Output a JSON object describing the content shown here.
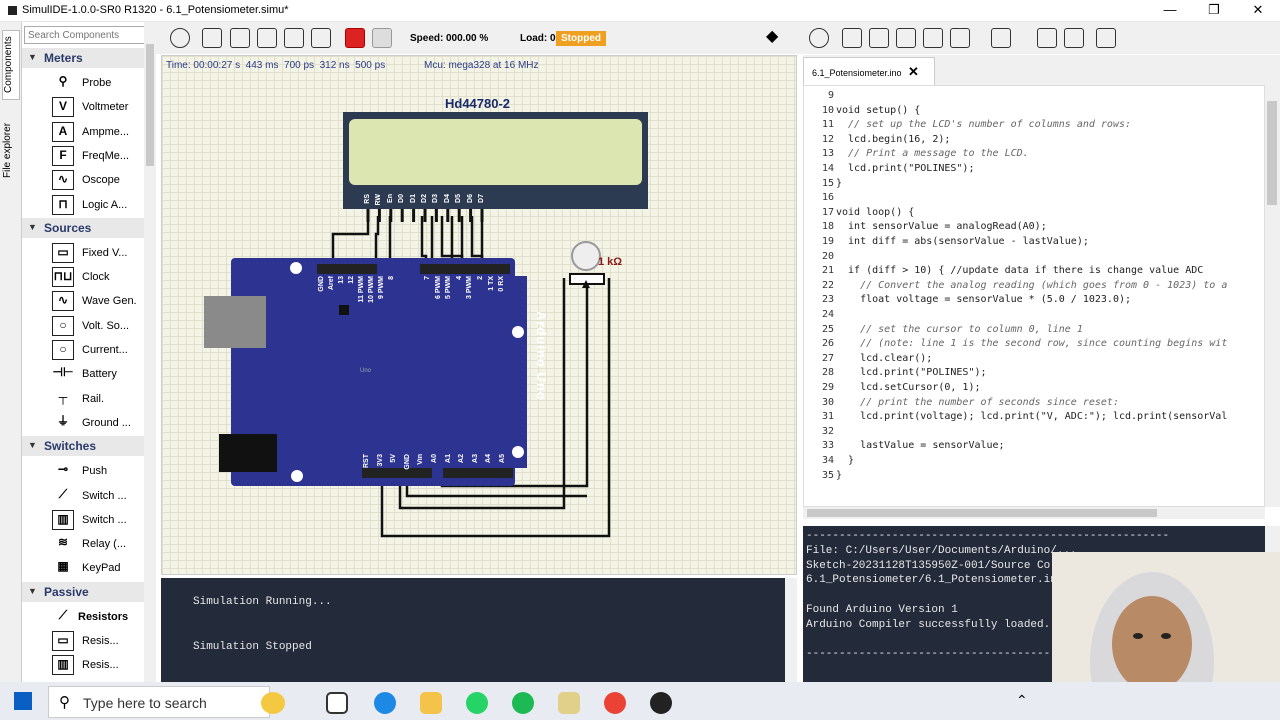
{
  "window": {
    "title": "SimulIDE-1.0.0-SR0 R1320 - 6.1_Potensiometer.simu*",
    "minimize": "—",
    "maximize": "❐",
    "close": "✕"
  },
  "sidebar_tabs": [
    "Components",
    "File explorer"
  ],
  "components": {
    "search_placeholder": "Search Components",
    "categories": [
      {
        "name": "Meters",
        "items": [
          {
            "label": "Probe",
            "icon": "probe-icon",
            "glyph": "⚲"
          },
          {
            "label": "Voltmeter",
            "icon": "voltmeter-icon",
            "glyph": "V"
          },
          {
            "label": "Ampme...",
            "icon": "ammeter-icon",
            "glyph": "A"
          },
          {
            "label": "FreqMe...",
            "icon": "freqmeter-icon",
            "glyph": "F"
          },
          {
            "label": "Oscope",
            "icon": "oscope-icon",
            "glyph": "∿"
          },
          {
            "label": "Logic A...",
            "icon": "logic-analyzer-icon",
            "glyph": "⊓"
          }
        ]
      },
      {
        "name": "Sources",
        "items": [
          {
            "label": "Fixed V...",
            "icon": "fixed-voltage-icon",
            "glyph": "▭"
          },
          {
            "label": "Clock",
            "icon": "clock-icon",
            "glyph": "⊓⊔"
          },
          {
            "label": "Wave Gen.",
            "icon": "wave-gen-icon",
            "glyph": "∿"
          },
          {
            "label": "Volt. So...",
            "icon": "voltage-source-icon",
            "glyph": "○"
          },
          {
            "label": "Current...",
            "icon": "current-source-icon",
            "glyph": "○"
          },
          {
            "label": "Battery",
            "icon": "battery-icon",
            "glyph": "⊣⊢"
          },
          {
            "label": "Rail.",
            "icon": "rail-icon",
            "glyph": "┬"
          },
          {
            "label": "Ground ...",
            "icon": "ground-icon",
            "glyph": "⏚"
          }
        ]
      },
      {
        "name": "Switches",
        "items": [
          {
            "label": "Push",
            "icon": "push-icon",
            "glyph": "⊸"
          },
          {
            "label": "Switch ...",
            "icon": "switch-icon",
            "glyph": "⟋"
          },
          {
            "label": "Switch ...",
            "icon": "switch-dip-icon",
            "glyph": "▥"
          },
          {
            "label": "Relay (...",
            "icon": "relay-icon",
            "glyph": "≋"
          },
          {
            "label": "KeyPad",
            "icon": "keypad-icon",
            "glyph": "▦"
          }
        ]
      },
      {
        "name": "Passive",
        "items": [
          {
            "label": "Resistors",
            "icon": "resistors-icon",
            "glyph": "⟋",
            "sub": true
          },
          {
            "label": "Resis...",
            "icon": "resistor-icon",
            "glyph": "▭"
          },
          {
            "label": "Resis...",
            "icon": "resistor-array-icon",
            "glyph": "▥"
          }
        ]
      }
    ]
  },
  "toolbar": {
    "speed_label": "Speed:",
    "speed_value": "000.00 %",
    "load_label": "Load:",
    "load_value": "000 %",
    "status": "Stopped"
  },
  "circuit": {
    "time": "Time: 00:00:27 s  443 ms  700 ps  312 ns  500 ps",
    "mcu": "Mcu: mega328 at 16 MHz",
    "lcd_title": "Hd44780-2",
    "lcd_pins": [
      "RS",
      "RW",
      "En",
      "D0",
      "D1",
      "D2",
      "D3",
      "D4",
      "D5",
      "D6",
      "D7"
    ],
    "arduino_label": "Arduino Uno",
    "arduino_small": "Uno",
    "pot_label": "1 kΩ",
    "header_top_left": [
      "GND",
      "Aref"
    ],
    "header_top_pins1": [
      "13",
      "12",
      "11 PWM",
      "10 PWM",
      "9 PWM",
      "8"
    ],
    "header_top_pins2": [
      "7",
      "6 PWM",
      "5 PWM",
      "4",
      "3 PWM",
      "2",
      "1 TX",
      "0 RX"
    ],
    "header_bottom": [
      "RST",
      "3V3",
      "5V",
      "GND",
      "Vin",
      "A0",
      "A1",
      "A2",
      "A3",
      "A4",
      "A5"
    ]
  },
  "console": {
    "lines": [
      "Simulation Running...",
      "Simulation Stopped"
    ]
  },
  "editor": {
    "tab": "6.1_Potensiometer.ino",
    "tab_close": "✕",
    "lines": [
      {
        "n": "9",
        "t": ""
      },
      {
        "n": "10",
        "t": "void setup() {"
      },
      {
        "n": "11",
        "t": "  // set up the LCD's number of columns and rows:"
      },
      {
        "n": "12",
        "t": "  lcd.begin(16, 2);"
      },
      {
        "n": "13",
        "t": "  // Print a message to the LCD."
      },
      {
        "n": "14",
        "t": "  lcd.print(\"POLINES\");"
      },
      {
        "n": "15",
        "t": "}"
      },
      {
        "n": "16",
        "t": ""
      },
      {
        "n": "17",
        "t": "void loop() {"
      },
      {
        "n": "18",
        "t": "  int sensorValue = analogRead(A0);"
      },
      {
        "n": "19",
        "t": "  int diff = abs(sensorValue - lastValue);"
      },
      {
        "n": "20",
        "t": ""
      },
      {
        "n": "21",
        "t": "  if (diff > 10) { //update data if there is change value ADC"
      },
      {
        "n": "22",
        "t": "    // Convert the analog reading (which goes from 0 - 1023) to a"
      },
      {
        "n": "23",
        "t": "    float voltage = sensorValue * (5.0 / 1023.0);"
      },
      {
        "n": "24",
        "t": ""
      },
      {
        "n": "25",
        "t": "    // set the cursor to column 0, line 1"
      },
      {
        "n": "26",
        "t": "    // (note: line 1 is the second row, since counting begins wit"
      },
      {
        "n": "27",
        "t": "    lcd.clear();"
      },
      {
        "n": "28",
        "t": "    lcd.print(\"POLINES\");"
      },
      {
        "n": "29",
        "t": "    lcd.setCursor(0, 1);"
      },
      {
        "n": "30",
        "t": "    // print the number of seconds since reset:"
      },
      {
        "n": "31",
        "t": "    lcd.print(voltage); lcd.print(\"V, ADC:\"); lcd.print(sensorVal"
      },
      {
        "n": "32",
        "t": ""
      },
      {
        "n": "33",
        "t": "    lastValue = sensorValue;"
      },
      {
        "n": "34",
        "t": "  }"
      },
      {
        "n": "35",
        "t": "}"
      }
    ]
  },
  "compile": {
    "lines": [
      "-------------------------------------------------------",
      "File: C:/Users/User/Documents/Arduino/...",
      "Sketch-20231128T135950Z-001/Source Co...",
      "6.1_Potensiometer/6.1_Potensiometer.in...",
      "",
      "Found Arduino Version 1",
      "Arduino Compiler successfully loaded.",
      "",
      "-------------------------------------------------------"
    ]
  },
  "taskbar": {
    "search_placeholder": "Type here to search"
  },
  "colors": {
    "accent": "#2a3a6a",
    "arduino": "#2d3390",
    "lcd_screen": "#dce6b0",
    "status_stopped": "#f0a020"
  }
}
